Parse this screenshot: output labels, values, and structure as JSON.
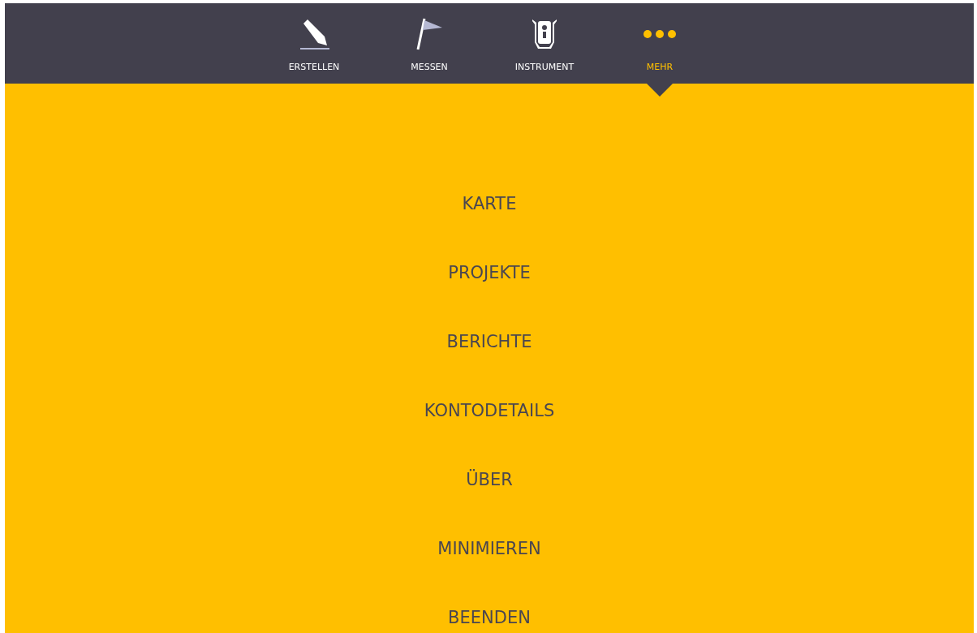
{
  "tabs": [
    {
      "label": "ERSTELLEN",
      "kind": "pencil",
      "selected": false
    },
    {
      "label": "MESSEN",
      "kind": "flag",
      "selected": false
    },
    {
      "label": "INSTRUMENT",
      "kind": "instrument",
      "selected": false
    },
    {
      "label": "MEHR",
      "kind": "more",
      "selected": true
    }
  ],
  "menu": [
    "KARTE",
    "PROJEKTE",
    "BERICHTE",
    "KONTODETAILS",
    "ÜBER",
    "MINIMIEREN",
    "BEENDEN"
  ]
}
